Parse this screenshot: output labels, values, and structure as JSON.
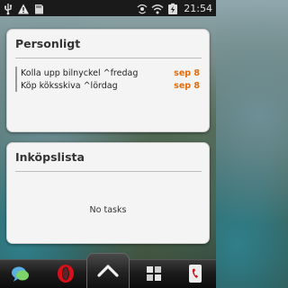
{
  "status_bar": {
    "time": "21:54",
    "left_icons": [
      "usb-icon",
      "warning-icon",
      "sd-card-icon"
    ],
    "right_icons": [
      "location-icon",
      "wifi-icon",
      "battery-charging-icon"
    ]
  },
  "widgets": [
    {
      "title": "Personligt",
      "tasks": [
        {
          "text": "Kolla upp bilnyckel ^fredag",
          "date": "sep 8"
        },
        {
          "text": "Köp köksskiva ^lördag",
          "date": "sep 8"
        }
      ]
    },
    {
      "title": "Inköpslista",
      "empty_text": "No tasks"
    }
  ],
  "dock": {
    "items": [
      "messaging-icon",
      "opera-browser-icon",
      "launcher-arrow-icon",
      "windows-tiles-icon",
      "phone-icon"
    ]
  },
  "colors": {
    "accent_date": "#e06d10",
    "widget_bg": "#f4f4f4",
    "status_bar_bg": "#1a1a1a"
  }
}
